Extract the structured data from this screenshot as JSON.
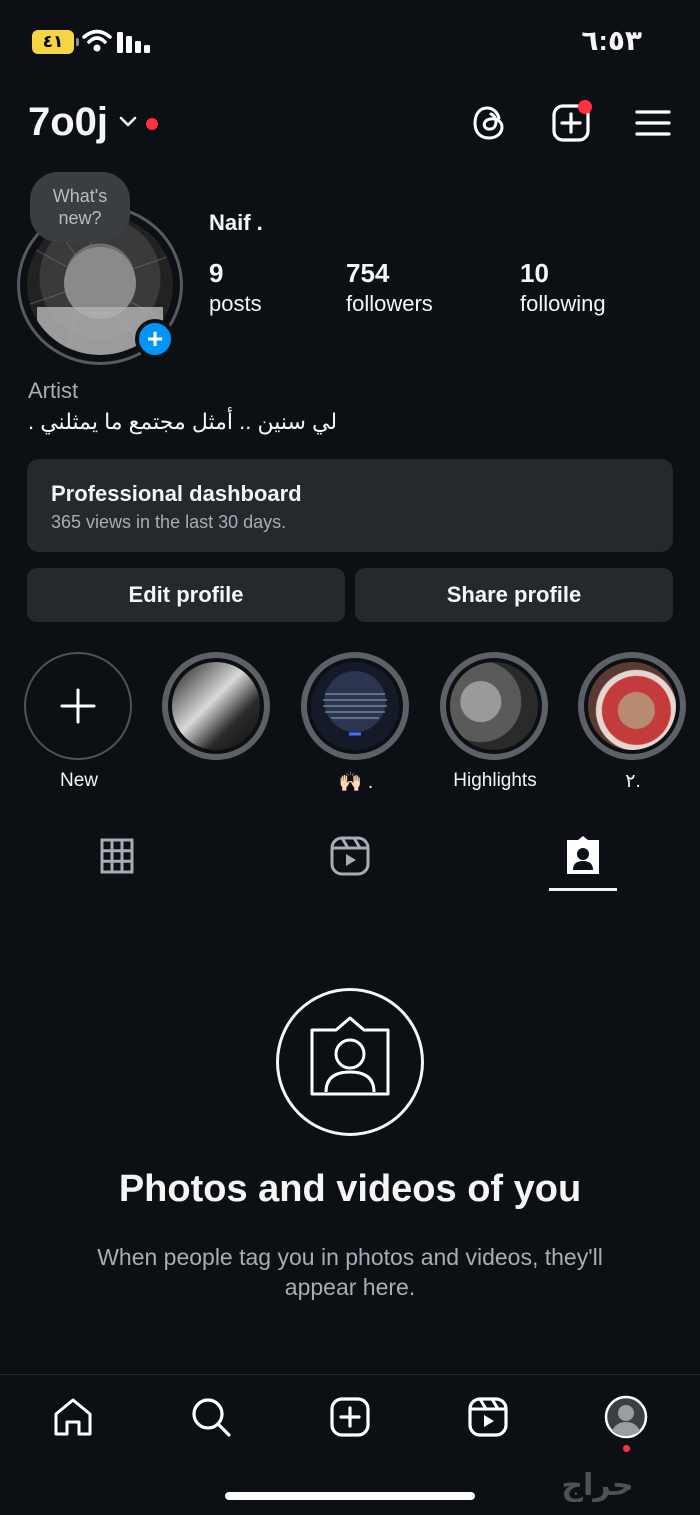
{
  "status_bar": {
    "battery": "٤١",
    "time": "٦:٥٣"
  },
  "header": {
    "username": "7o0j",
    "icons": [
      "threads-icon",
      "create-icon",
      "menu-icon"
    ]
  },
  "profile": {
    "note_prompt": "What's new?",
    "full_name": "Naif .",
    "stats": [
      {
        "value": "9",
        "label": "posts"
      },
      {
        "value": "754",
        "label": "followers"
      },
      {
        "value": "10",
        "label": "following"
      }
    ],
    "category": "Artist",
    "bio": "لي سنين .. أمثل مجتمع ما يمثلني ."
  },
  "dashboard": {
    "title": "Professional dashboard",
    "subtitle": "365 views in the last 30 days."
  },
  "buttons": {
    "edit": "Edit profile",
    "share": "Share profile"
  },
  "highlights": [
    {
      "label": "New"
    },
    {
      "label": ""
    },
    {
      "label": "🙌🏻 ."
    },
    {
      "label": "Highlights"
    },
    {
      "label": "٢."
    }
  ],
  "tabs": [
    "grid-icon",
    "reels-icon",
    "tagged-icon"
  ],
  "empty_state": {
    "title": "Photos and videos of you",
    "subtitle": "When people tag you in photos and videos, they'll appear here."
  },
  "bottom_nav": [
    "home-icon",
    "search-icon",
    "create-icon",
    "reels-icon",
    "profile-icon"
  ],
  "watermark": "حراج",
  "colors": {
    "background": "#0c1014",
    "button": "#25292e",
    "accent_blue": "#0095f6",
    "notification_red": "#ff3040"
  }
}
